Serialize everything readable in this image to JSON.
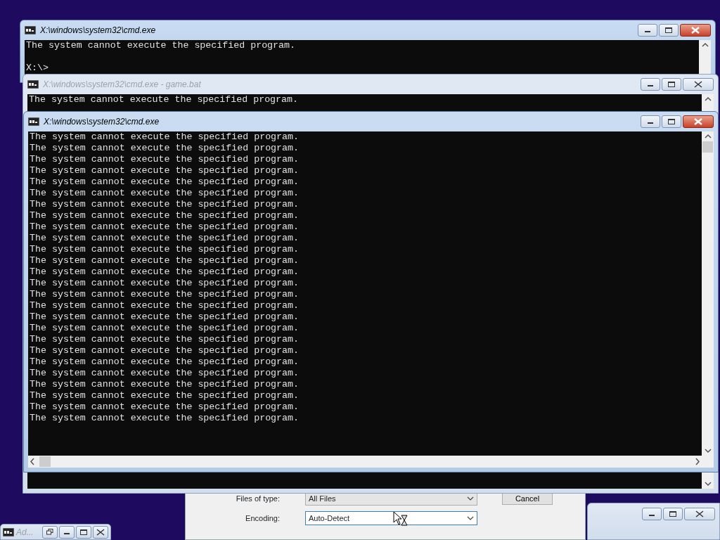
{
  "windows": [
    {
      "title": "X:\\windows\\system32\\cmd.exe",
      "active": true,
      "lines": [
        "The system cannot execute the specified program."
      ],
      "prompt": "X:\\>"
    },
    {
      "title": "X:\\windows\\system32\\cmd.exe - game.bat",
      "active": false,
      "lines": [
        "The system cannot execute the specified program."
      ]
    },
    {
      "title": "X:\\windows\\system32\\cmd.exe",
      "active": true,
      "lines": [
        "The system cannot execute the specified program.",
        "The system cannot execute the specified program.",
        "The system cannot execute the specified program.",
        "The system cannot execute the specified program.",
        "The system cannot execute the specified program.",
        "The system cannot execute the specified program.",
        "The system cannot execute the specified program.",
        "The system cannot execute the specified program.",
        "The system cannot execute the specified program.",
        "The system cannot execute the specified program.",
        "The system cannot execute the specified program.",
        "The system cannot execute the specified program.",
        "The system cannot execute the specified program.",
        "The system cannot execute the specified program.",
        "The system cannot execute the specified program.",
        "The system cannot execute the specified program.",
        "The system cannot execute the specified program.",
        "The system cannot execute the specified program.",
        "The system cannot execute the specified program.",
        "The system cannot execute the specified program.",
        "The system cannot execute the specified program.",
        "The system cannot execute the specified program.",
        "The system cannot execute the specified program.",
        "The system cannot execute the specified program.",
        "The system cannot execute the specified program.",
        "The system cannot execute the specified program."
      ]
    }
  ],
  "dialog": {
    "rows": [
      {
        "label": "Files of type:",
        "value": "All Files",
        "focused": false
      },
      {
        "label": "Encoding:",
        "value": "Auto-Detect",
        "focused": true
      }
    ],
    "cancel": "Cancel"
  },
  "minimized": {
    "title": "Ad..."
  }
}
